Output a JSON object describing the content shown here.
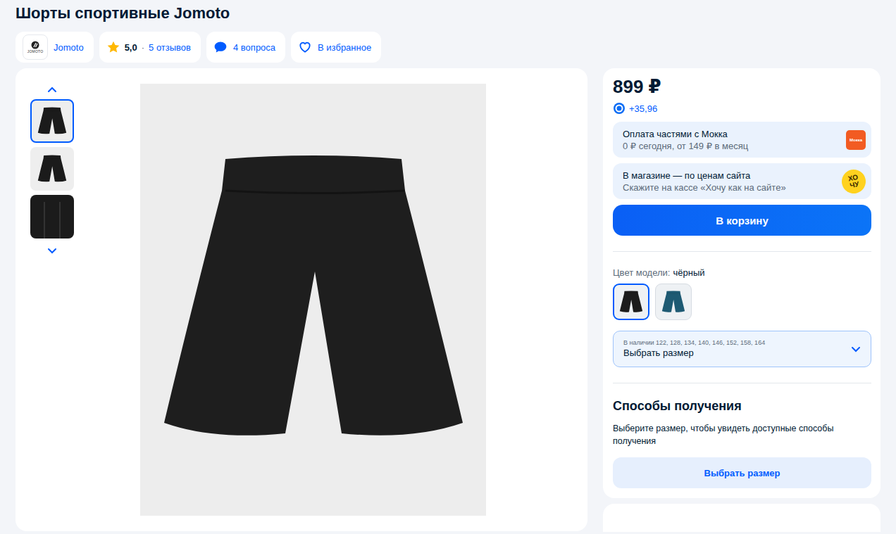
{
  "title": "Шорты спортивные Jomoto",
  "brand": {
    "logo_text": "JOMOTO",
    "name": "Jomoto"
  },
  "rating": {
    "score": "5,0",
    "separator": "·",
    "reviews": "5 отзывов"
  },
  "questions": "4 вопроса",
  "favorite": "В избранное",
  "gallery": {
    "thumbnails": [
      {
        "selected": true
      },
      {
        "selected": false
      },
      {
        "selected": false
      }
    ]
  },
  "price": "899 ₽",
  "bonus": "+35,96",
  "offers": [
    {
      "title": "Оплата частями с Мокка",
      "subtitle": "0 ₽ сегодня, от 149 ₽ в месяц",
      "badge": "Мокка",
      "kind": "mokka"
    },
    {
      "title": "В магазине — по ценам сайта",
      "subtitle": "Скажите на кассе «Хочу как на сайте»",
      "badge": "ХОЧУ",
      "kind": "hochu"
    }
  ],
  "cart_button": "В корзину",
  "color": {
    "label": "Цвет модели:",
    "value": "чёрный",
    "swatches": [
      {
        "color": "#1c1c1c",
        "selected": true
      },
      {
        "color": "#1e5a73",
        "selected": false
      }
    ]
  },
  "size": {
    "availability": "В наличии 122, 128, 134, 140, 146, 152, 158, 164",
    "placeholder": "Выбрать размер"
  },
  "delivery": {
    "title": "Способы получения",
    "hint": "Выберите размер, чтобы увидеть доступные способы получения",
    "button": "Выбрать размер"
  }
}
